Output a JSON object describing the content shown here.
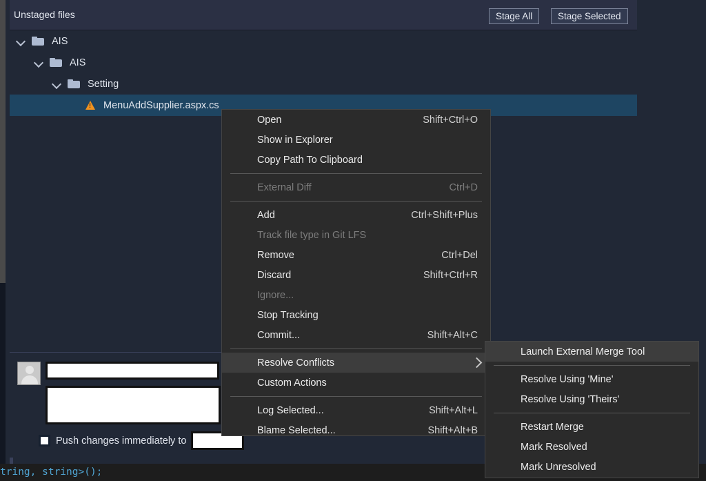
{
  "header": {
    "title": "Unstaged files",
    "stage_all_label": "Stage All",
    "stage_selected_label": "Stage Selected"
  },
  "tree": {
    "rows": [
      {
        "label": "AIS",
        "type": "folder",
        "indent": 10,
        "selected": false,
        "icon": "chevron-down-icon"
      },
      {
        "label": "AIS",
        "type": "folder",
        "indent": 36,
        "selected": false,
        "icon": "chevron-down-icon"
      },
      {
        "label": "Setting",
        "type": "folder",
        "indent": 62,
        "selected": false,
        "icon": "chevron-down-icon"
      },
      {
        "label": "MenuAddSupplier.aspx.cs",
        "type": "file",
        "indent": 110,
        "selected": true,
        "icon": "warning-icon"
      }
    ]
  },
  "commit": {
    "summary_value": "",
    "description_value": "",
    "push_label": "Push changes immediately to",
    "push_checked": false,
    "branch_value": ""
  },
  "context_menu": {
    "items": [
      {
        "label": "Open",
        "shortcut": "Shift+Ctrl+O",
        "disabled": false,
        "highlighted": false,
        "submenu": false
      },
      {
        "label": "Show in Explorer",
        "shortcut": "",
        "disabled": false,
        "highlighted": false,
        "submenu": false
      },
      {
        "label": "Copy Path To Clipboard",
        "shortcut": "",
        "disabled": false,
        "highlighted": false,
        "submenu": false
      },
      {
        "separator": true
      },
      {
        "label": "External Diff",
        "shortcut": "Ctrl+D",
        "disabled": true,
        "highlighted": false,
        "submenu": false
      },
      {
        "separator": true
      },
      {
        "label": "Add",
        "shortcut": "Ctrl+Shift+Plus",
        "disabled": false,
        "highlighted": false,
        "submenu": false
      },
      {
        "label": "Track file type in Git LFS",
        "shortcut": "",
        "disabled": true,
        "highlighted": false,
        "submenu": false
      },
      {
        "label": "Remove",
        "shortcut": "Ctrl+Del",
        "disabled": false,
        "highlighted": false,
        "submenu": false
      },
      {
        "label": "Discard",
        "shortcut": "Shift+Ctrl+R",
        "disabled": false,
        "highlighted": false,
        "submenu": false
      },
      {
        "label": "Ignore...",
        "shortcut": "",
        "disabled": true,
        "highlighted": false,
        "submenu": false
      },
      {
        "label": "Stop Tracking",
        "shortcut": "",
        "disabled": false,
        "highlighted": false,
        "submenu": false
      },
      {
        "label": "Commit...",
        "shortcut": "Shift+Alt+C",
        "disabled": false,
        "highlighted": false,
        "submenu": false
      },
      {
        "separator": true
      },
      {
        "label": "Resolve Conflicts",
        "shortcut": "",
        "disabled": false,
        "highlighted": true,
        "submenu": true
      },
      {
        "label": "Custom Actions",
        "shortcut": "",
        "disabled": false,
        "highlighted": false,
        "submenu": false
      },
      {
        "separator": true
      },
      {
        "label": "Log Selected...",
        "shortcut": "Shift+Alt+L",
        "disabled": false,
        "highlighted": false,
        "submenu": false
      },
      {
        "label": "Blame Selected...",
        "shortcut": "Shift+Alt+B",
        "disabled": false,
        "highlighted": false,
        "submenu": false
      }
    ]
  },
  "submenu": {
    "items": [
      {
        "label": "Launch External Merge Tool",
        "shortcut": "",
        "disabled": false,
        "highlighted": true,
        "submenu": false
      },
      {
        "separator": true
      },
      {
        "label": "Resolve Using 'Mine'",
        "shortcut": "",
        "disabled": false,
        "highlighted": false,
        "submenu": false
      },
      {
        "label": "Resolve Using 'Theirs'",
        "shortcut": "",
        "disabled": false,
        "highlighted": false,
        "submenu": false
      },
      {
        "separator": true
      },
      {
        "label": "Restart Merge",
        "shortcut": "",
        "disabled": false,
        "highlighted": false,
        "submenu": false
      },
      {
        "label": "Mark Resolved",
        "shortcut": "",
        "disabled": false,
        "highlighted": false,
        "submenu": false
      },
      {
        "label": "Mark Unresolved",
        "shortcut": "",
        "disabled": false,
        "highlighted": false,
        "submenu": false
      }
    ]
  },
  "code_strip": {
    "text": "tring, string>();"
  },
  "colors": {
    "panel_bg": "#212836",
    "header_bg": "#2b3044",
    "selection_blue": "#1e4562",
    "menu_bg": "#2b2b2b",
    "menu_highlight": "#3d3d3d",
    "warning_orange": "#f0921e",
    "code_blue": "#4fa3d1"
  }
}
